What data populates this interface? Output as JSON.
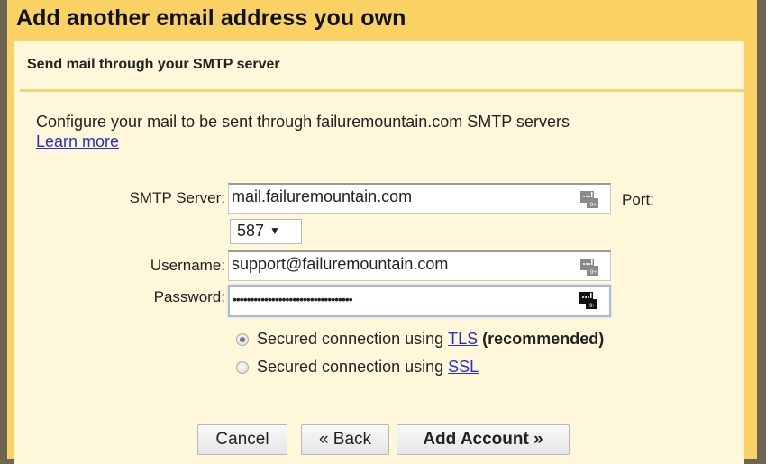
{
  "dialog": {
    "title": "Add another email address you own",
    "subtitle": "Send mail through your SMTP server",
    "description": "Configure your mail to be sent through failuremountain.com SMTP servers",
    "learn_more": "Learn more"
  },
  "form": {
    "smtp_server": {
      "label": "SMTP Server:",
      "value": "mail.failuremountain.com",
      "icon": "password-manager-key-icon"
    },
    "port": {
      "label": "Port:",
      "selected": "587",
      "arrow": "▼"
    },
    "username": {
      "label": "Username:",
      "value": "support@failuremountain.com",
      "icon": "password-manager-key-icon"
    },
    "password": {
      "label": "Password:",
      "value": "••••••••••••••••••••••••••••••••••",
      "icon": "password-manager-key-icon",
      "focused": true
    },
    "security": {
      "options": [
        {
          "prefix": "Secured connection using ",
          "link": "TLS",
          "suffix": " (recommended)",
          "checked": true
        },
        {
          "prefix": "Secured connection using ",
          "link": "SSL",
          "suffix": "",
          "checked": false
        }
      ]
    }
  },
  "buttons": {
    "cancel": "Cancel",
    "back": "« Back",
    "add_account": "Add Account »"
  },
  "colors": {
    "header": "#fad163",
    "panel": "#fff7da",
    "link": "#2a2fc8",
    "separator": "#f2d27d"
  }
}
